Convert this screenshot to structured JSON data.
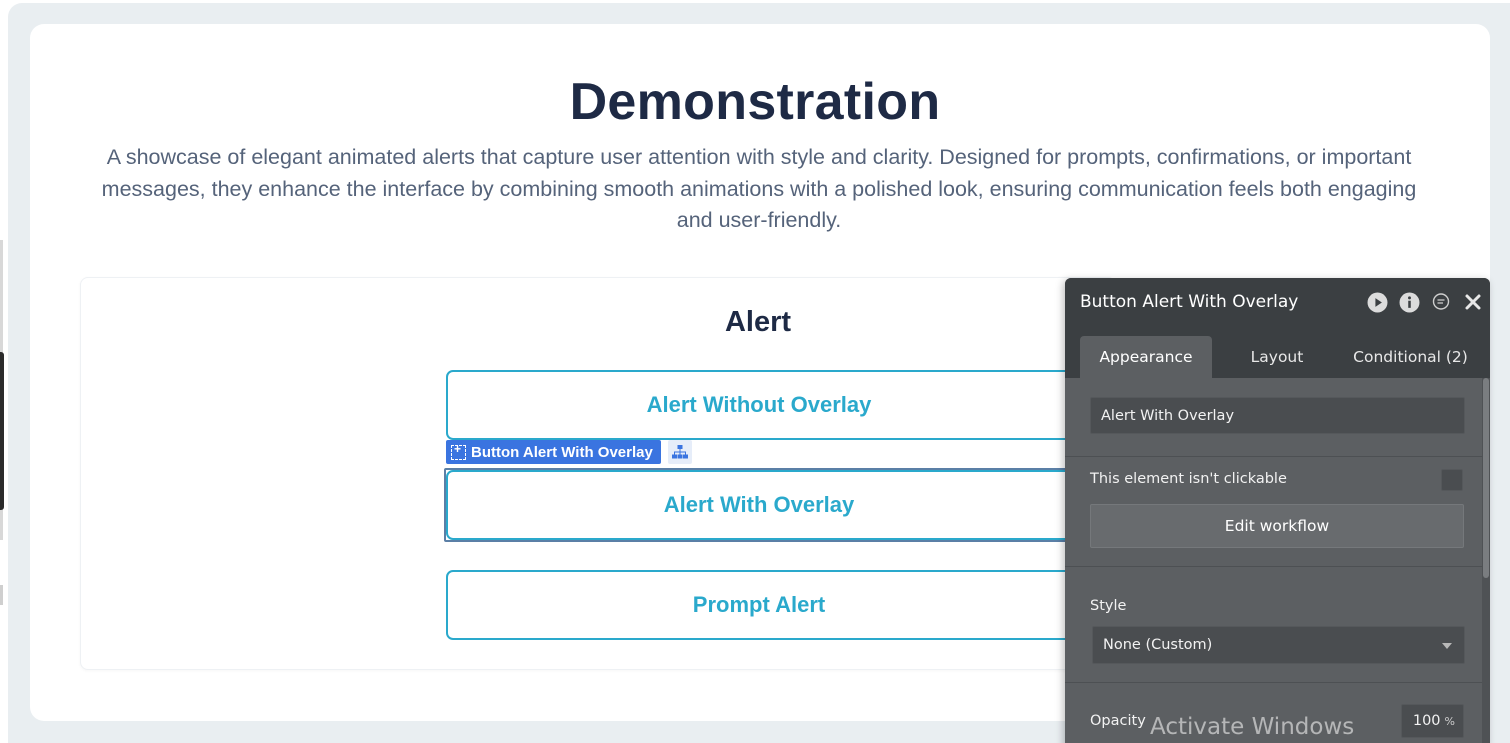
{
  "page": {
    "title": "Demonstration",
    "description": "A showcase of elegant animated alerts that capture user attention with style and clarity. Designed for prompts, confirmations, or important messages, they enhance the interface by combining smooth animations with a polished look, ensuring communication feels both engaging and user-friendly."
  },
  "alert_section": {
    "title": "Alert",
    "buttons": [
      {
        "label": "Alert Without Overlay"
      },
      {
        "label": "Alert With Overlay"
      },
      {
        "label": "Prompt Alert"
      }
    ],
    "accent_color": "#2aa9cc"
  },
  "selection": {
    "tag_label": "Button Alert With Overlay",
    "tag_icon": "frame-select-icon",
    "tree_icon": "element-tree-icon"
  },
  "inspector": {
    "title": "Button Alert With Overlay",
    "header_icons": [
      "preview-play-icon",
      "info-icon",
      "comment-icon",
      "close-icon"
    ],
    "tabs": [
      {
        "label": "Appearance",
        "active": true
      },
      {
        "label": "Layout",
        "active": false
      },
      {
        "label": "Conditional (2)",
        "active": false
      }
    ],
    "button_text_value": "Alert With Overlay",
    "not_clickable_label": "This element isn't clickable",
    "not_clickable_checked": false,
    "edit_workflow_label": "Edit workflow",
    "style_label": "Style",
    "style_value": "None (Custom)",
    "opacity_label": "Opacity",
    "opacity_value": "100",
    "opacity_unit": "%"
  },
  "watermark": "Activate Windows"
}
